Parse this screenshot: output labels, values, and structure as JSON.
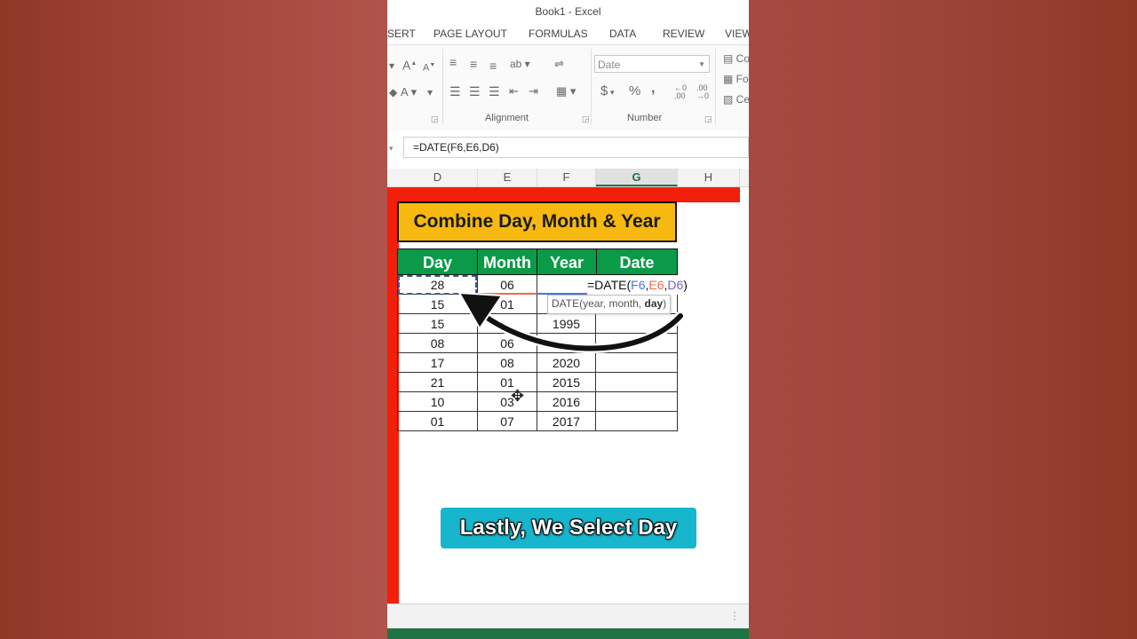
{
  "window": {
    "title": "Book1 - Excel"
  },
  "ribbon": {
    "tabs": [
      "SERT",
      "PAGE LAYOUT",
      "FORMULAS",
      "DATA",
      "REVIEW",
      "VIEW"
    ],
    "groups": {
      "alignment": "Alignment",
      "number": "Number"
    },
    "number_format": "Date",
    "currency_symbol": "$",
    "percent_symbol": "%",
    "comma_symbol": ",",
    "styles_items": [
      "Co",
      "Fo",
      "Ce"
    ]
  },
  "formula_bar": {
    "value": "=DATE(F6,E6,D6)"
  },
  "columns": [
    "D",
    "E",
    "F",
    "G",
    "H"
  ],
  "selected_column": "G",
  "sheet": {
    "title": "Combine Day, Month & Year",
    "headers": [
      "Day",
      "Month",
      "Year",
      "Date"
    ],
    "rows": [
      [
        "28",
        "06",
        "",
        ""
      ],
      [
        "15",
        "01",
        "",
        ""
      ],
      [
        "15",
        "",
        "1995",
        ""
      ],
      [
        "08",
        "06",
        "",
        ""
      ],
      [
        "17",
        "08",
        "2020",
        ""
      ],
      [
        "21",
        "01",
        "2015",
        ""
      ],
      [
        "10",
        "03",
        "2016",
        ""
      ],
      [
        "01",
        "07",
        "2017",
        ""
      ]
    ]
  },
  "editing_formula": {
    "prefix": "=DATE(",
    "arg1": "F6",
    "sep1": ",",
    "arg2": "E6",
    "sep2": ",",
    "arg3": "D6",
    "suffix": ")"
  },
  "tooltip": {
    "prefix": "DATE(year, month, ",
    "current_arg": "day",
    "suffix": ")"
  },
  "caption": "Lastly, We Select Day",
  "colors": {
    "header_green": "#0a9a48",
    "title_yellow": "#f7b90f",
    "red_decor": "#f21f0a",
    "caption_bg": "#17b6cd",
    "ref_blue": "#4a77d4",
    "ref_orange": "#ee6a4a",
    "ref_purple": "#7a5cc2"
  }
}
